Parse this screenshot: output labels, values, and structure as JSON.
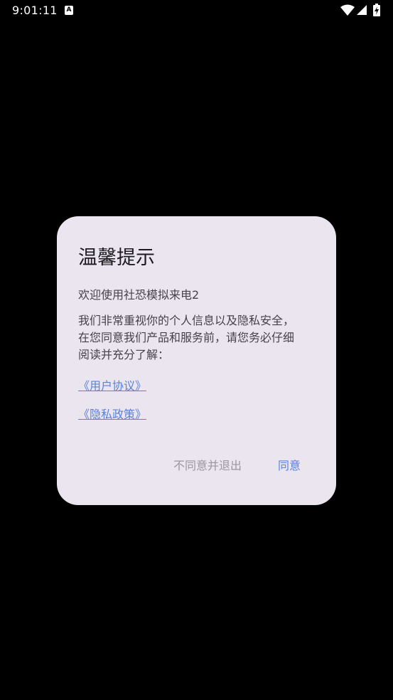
{
  "status_bar": {
    "time": "9:01:11",
    "notification_icon_letter": "A",
    "icons": [
      "notification-a-icon",
      "wifi-icon",
      "cellular-signal-icon",
      "battery-charging-icon"
    ]
  },
  "dialog": {
    "title": "温馨提示",
    "welcome": "欢迎使用社恐模拟来电2",
    "body_lines": [
      "我们非常重视你的个人信息以及隐私安全，",
      "在您同意我们产品和服务前，请您务必仔细",
      "阅读并充分了解："
    ],
    "link_user_agreement": "《用户协议》",
    "link_privacy_policy": "《隐私政策》",
    "btn_disagree": "不同意并退出",
    "btn_agree": "同意"
  },
  "colors": {
    "background": "#000000",
    "dialog_bg": "#ebe5ef",
    "title": "#1c1b1f",
    "body_text": "#45424a",
    "accent_link": "#5b82d6",
    "muted_button": "#9a979f"
  }
}
